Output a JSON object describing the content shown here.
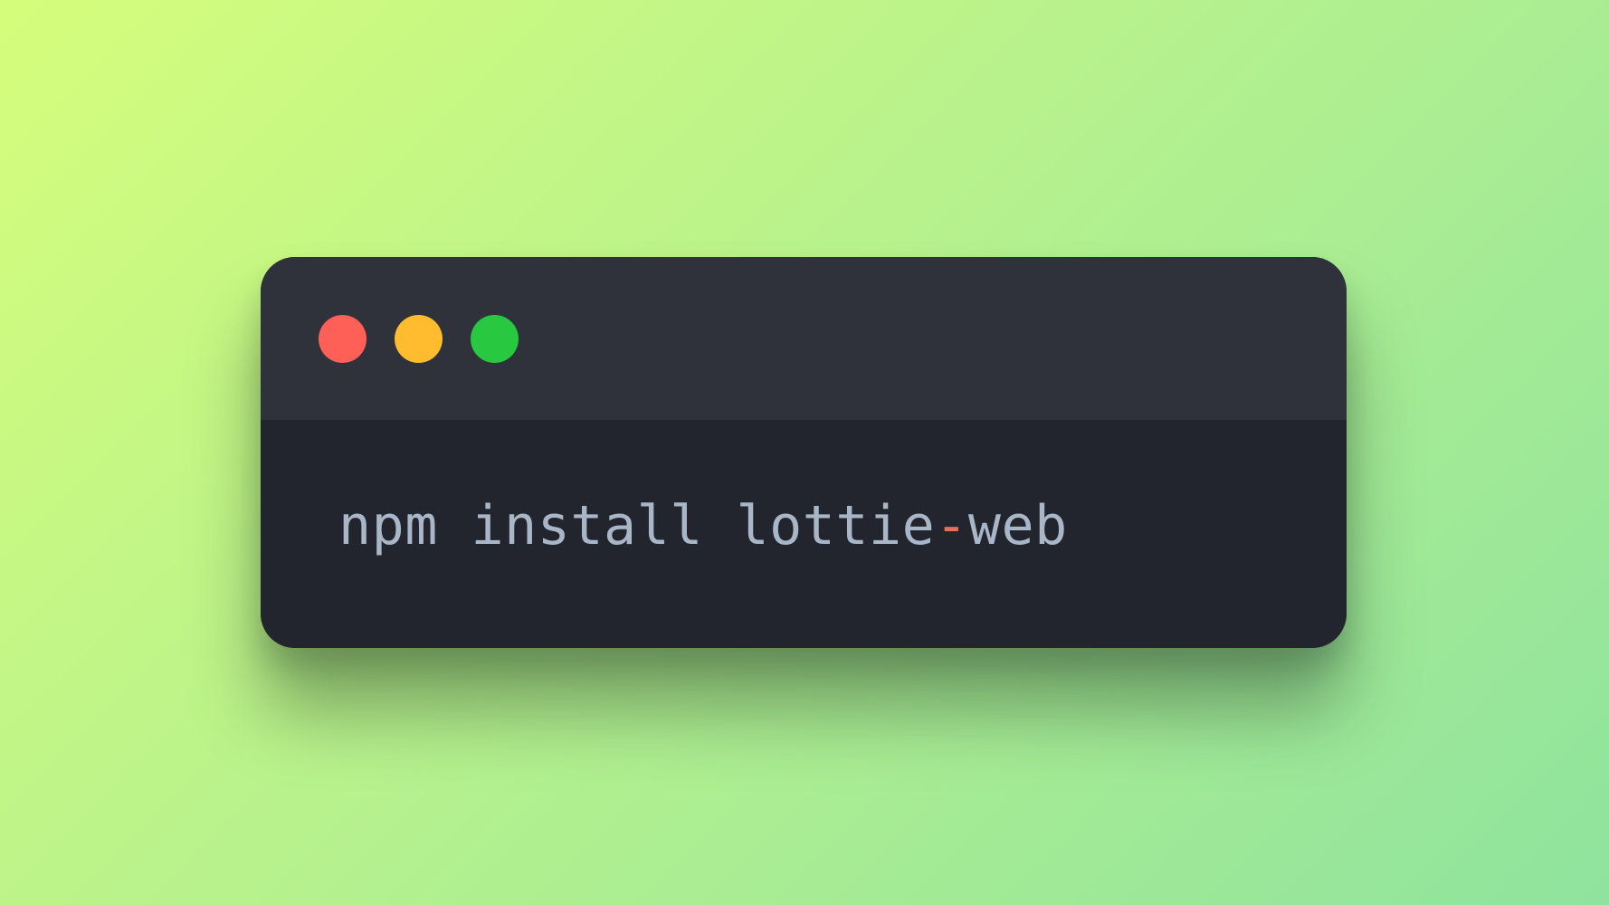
{
  "colors": {
    "background_start": "#d5fd7b",
    "background_end": "#8fe39e",
    "window_body": "#22252d",
    "titlebar": "#2f323a",
    "close": "#fe5f57",
    "minimize": "#febc2e",
    "maximize": "#28c840",
    "text": "#a9b6c8",
    "operator": "#e86e5d"
  },
  "window_controls": {
    "close_icon": "close-dot",
    "minimize_icon": "minimize-dot",
    "maximize_icon": "maximize-dot"
  },
  "code": {
    "part1": "npm install lottie",
    "operator": "-",
    "part2": "web"
  }
}
